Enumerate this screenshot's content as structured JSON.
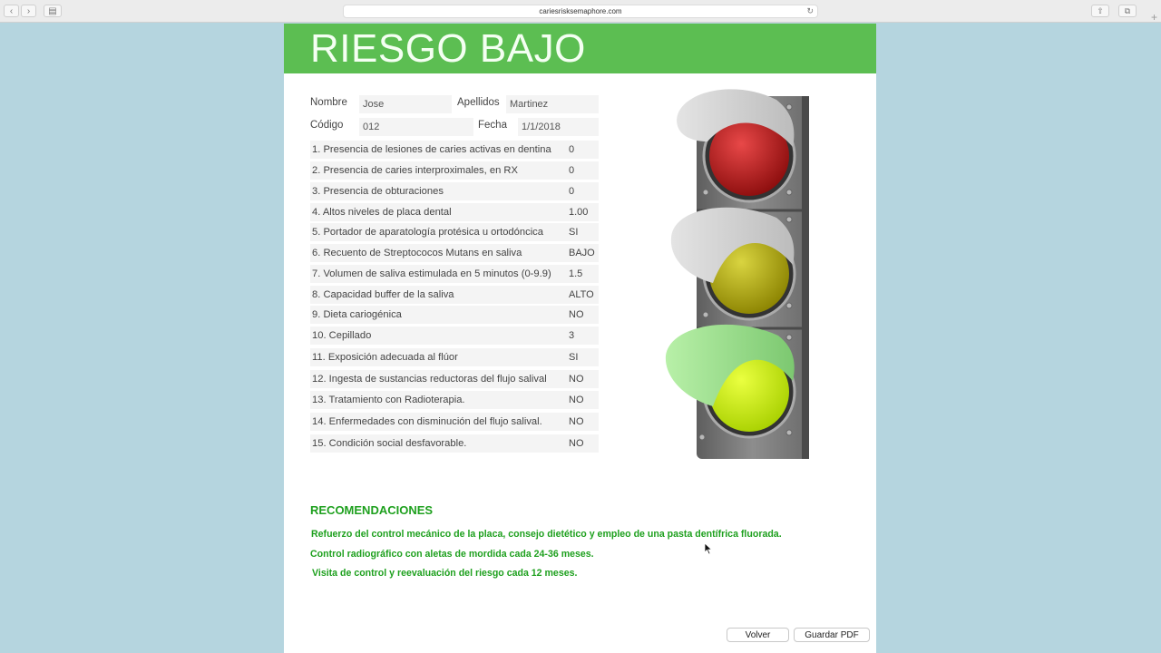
{
  "browser": {
    "url": "cariesrisksemaphore.com"
  },
  "page": {
    "title": "RIESGO BAJO",
    "patient": {
      "nombre_label": "Nombre",
      "nombre_value": "Jose",
      "apellidos_label": "Apellidos",
      "apellidos_value": "Martinez",
      "codigo_label": "Código",
      "codigo_value": "012",
      "fecha_label": "Fecha",
      "fecha_value": "1/1/2018"
    },
    "questions": [
      {
        "q": "1. Presencia de lesiones de caries activas en dentina",
        "a": "0"
      },
      {
        "q": "2. Presencia de caries interproximales, en RX",
        "a": "0"
      },
      {
        "q": "3. Presencia de obturaciones",
        "a": "0"
      },
      {
        "q": "4. Altos niveles de placa dental",
        "a": "1.00"
      },
      {
        "q": "5. Portador de aparatología protésica u ortodóncica",
        "a": "SI"
      },
      {
        "q": "6. Recuento de Streptococos Mutans en saliva",
        "a": "BAJO"
      },
      {
        "q": "7. Volumen de saliva estimulada en 5 minutos (0-9.9)",
        "a": "1.5"
      },
      {
        "q": "8. Capacidad buffer de la saliva",
        "a": "ALTO"
      },
      {
        "q": "9. Dieta cariogénica",
        "a": "NO"
      },
      {
        "q": "10. Cepillado",
        "a": "3"
      },
      {
        "q": "11. Exposición adecuada al flúor",
        "a": "SI"
      },
      {
        "q": "12. Ingesta de sustancias reductoras del flujo salival",
        "a": "NO"
      },
      {
        "q": "13. Tratamiento con Radioterapia.",
        "a": "NO"
      },
      {
        "q": "14. Enfermedades con disminución del flujo salival.",
        "a": "NO"
      },
      {
        "q": "15. Condición social desfavorable.",
        "a": "NO"
      }
    ],
    "recommendations": {
      "title": "RECOMENDACIONES",
      "items": [
        "Refuerzo del control mecánico de la placa, consejo dietético y empleo de una pasta dentífrica fluorada.",
        "Control radiográfico con aletas de mordida cada 24-36 meses.",
        "Visita de control y reevaluación del riesgo cada 12 meses."
      ]
    },
    "buttons": {
      "back": "Volver",
      "save_pdf": "Guardar PDF"
    },
    "colors": {
      "banner": "#5cbe52",
      "recommendation_text": "#1ea01e",
      "light_red": "#b01818",
      "light_yellow": "#b8b400",
      "light_green": "#ccf000"
    }
  }
}
